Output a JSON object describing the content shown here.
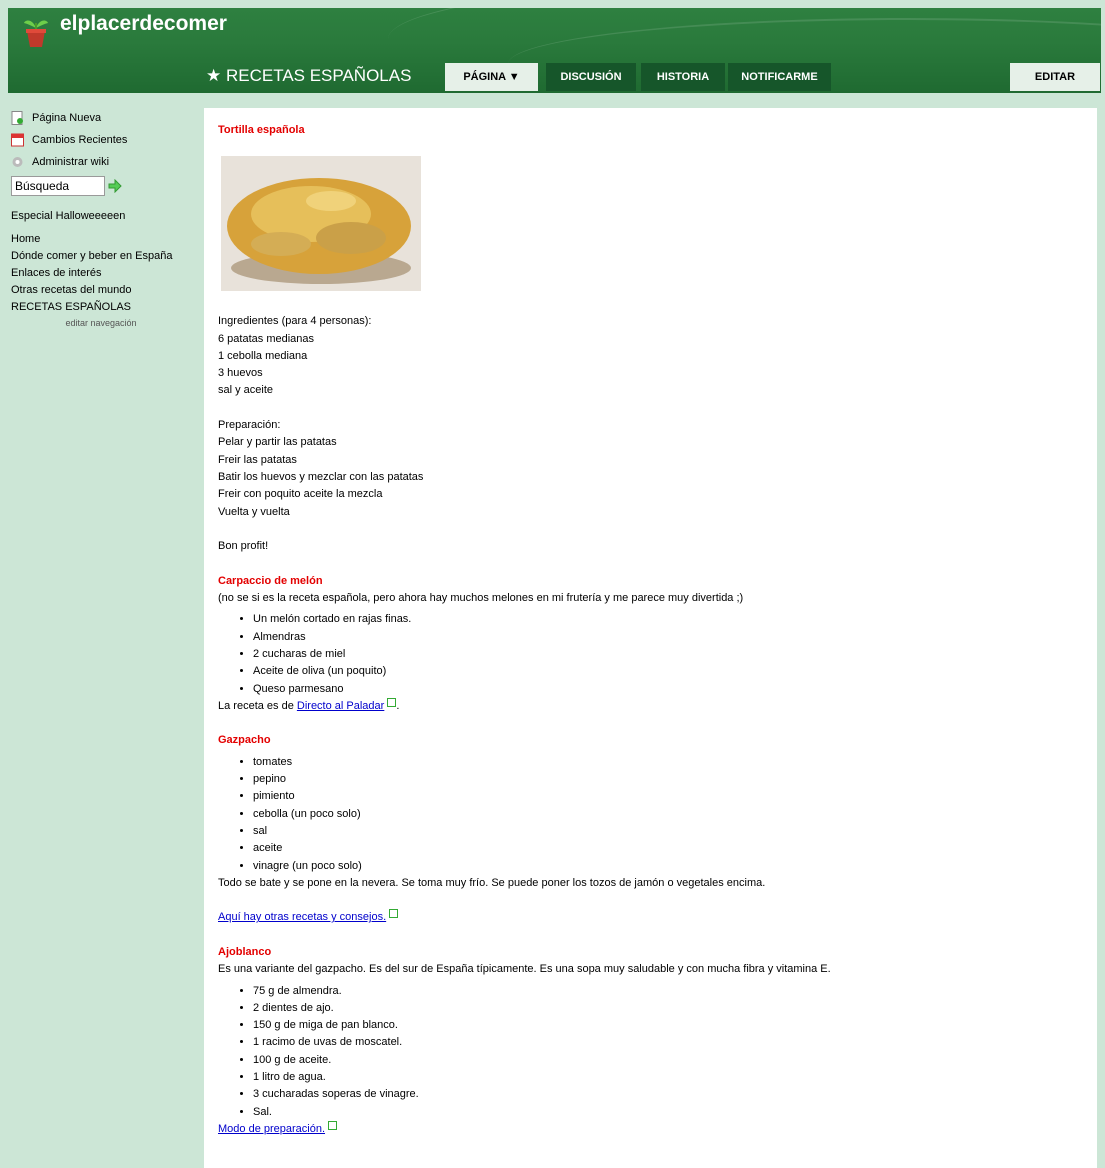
{
  "site": {
    "title": "elplacerdecomer"
  },
  "page": {
    "title": "★ RECETAS ESPAÑOLAS"
  },
  "tabs": {
    "pagina": "PÁGINA ▼",
    "discusion": "DISCUSIÓN",
    "historia": "HISTORIA",
    "notificarme": "NOTIFICARME",
    "editar": "EDITAR"
  },
  "sidebar": {
    "tools": [
      "Página Nueva",
      "Cambios Recientes",
      "Administrar wiki"
    ],
    "search_value": "Búsqueda",
    "special": "Especial Halloweeeeen",
    "nav": [
      "Home",
      "Dónde comer y beber en España",
      "Enlaces de interés",
      "Otras recetas del mundo",
      "RECETAS ESPAÑOLAS"
    ],
    "edit_nav": "editar navegación"
  },
  "recipes": {
    "tortilla": {
      "title": "Tortilla española",
      "ingredients": [
        "Ingredientes (para 4 personas):",
        "6 patatas medianas",
        "1 cebolla mediana",
        "3 huevos",
        "sal y aceite"
      ],
      "preparation": [
        "Preparación:",
        "Pelar y partir las patatas",
        "Freir las patatas",
        "Batir los huevos y mezclar con las patatas",
        "Freir con poquito aceite la mezcla",
        "Vuelta y vuelta"
      ],
      "closing": "Bon profit!"
    },
    "carpaccio": {
      "title": "Carpaccio de melón",
      "intro": "(no se si es la receta española, pero ahora hay muchos melones en mi frutería y me parece muy divertida ;)",
      "items": [
        "Un melón cortado en rajas finas.",
        "Almendras",
        "2 cucharas de miel",
        "Aceite de oliva (un poquito)",
        "Queso parmesano"
      ],
      "source_prefix": "La receta es de ",
      "source_link": "Directo al Paladar",
      "source_suffix": "."
    },
    "gazpacho": {
      "title": "Gazpacho",
      "items": [
        "tomates",
        "pepino",
        "pimiento",
        "cebolla (un poco solo)",
        "sal",
        "aceite",
        "vinagre (un poco solo)"
      ],
      "note": "Todo se bate y se pone en la nevera. Se toma muy frío. Se puede poner los tozos de jamón o vegetales encima.",
      "link": "Aquí hay otras recetas y consejos."
    },
    "ajoblanco": {
      "title": "Ajoblanco",
      "intro": "Es una variante del gazpacho. Es del sur de España típicamente. Es una sopa muy saludable y con mucha fibra y vitamina E.",
      "items": [
        "75 g de almendra.",
        "2 dientes de ajo.",
        "150 g de miga de pan blanco.",
        "1 racimo de uvas de moscatel.",
        "100 g de aceite.",
        "1 litro de agua.",
        "3 cucharadas soperas de vinagre.",
        "Sal."
      ],
      "link": "Modo de preparación."
    }
  }
}
